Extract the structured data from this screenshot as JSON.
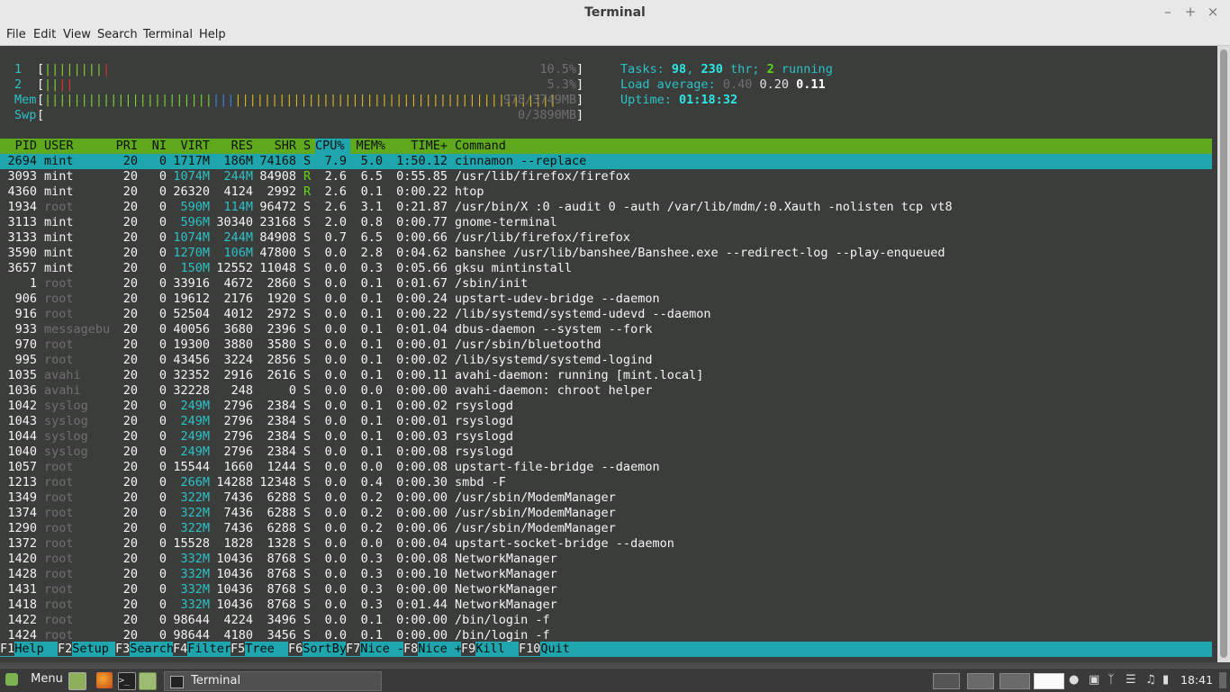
{
  "window": {
    "title": "Terminal"
  },
  "menubar": {
    "items": [
      "File",
      "Edit",
      "View",
      "Search",
      "Terminal",
      "Help"
    ]
  },
  "meters": {
    "cpu1_label": "1",
    "cpu1_value": "10.5%",
    "cpu2_label": "2",
    "cpu2_value": "5.3%",
    "mem_label": "Mem",
    "mem_value": "978/3749MB",
    "swp_label": "Swp",
    "swp_value": "0/3890MB"
  },
  "summary": {
    "tasks_label": "Tasks:",
    "tasks": "98",
    "threads": "230",
    "thr_label": "thr;",
    "running": "2",
    "running_label": "running",
    "load_label": "Load average:",
    "load1": "0.40",
    "load5": "0.20",
    "load15": "0.11",
    "uptime_label": "Uptime:",
    "uptime": "01:18:32"
  },
  "table": {
    "headers": {
      "pid": "PID",
      "user": "USER",
      "pri": "PRI",
      "ni": "NI",
      "virt": "VIRT",
      "res": "RES",
      "shr": "SHR",
      "s": "S",
      "cpu": "CPU%",
      "mem": "MEM%",
      "time": "TIME+",
      "cmd": "Command"
    },
    "rows": [
      [
        "2694",
        "mint",
        "20",
        "0",
        "1717M",
        "186M",
        "74168",
        "S",
        "7.9",
        "5.0",
        "1:50.12",
        "cinnamon --replace"
      ],
      [
        "3093",
        "mint",
        "20",
        "0",
        "1074M",
        "244M",
        "84908",
        "R",
        "2.6",
        "6.5",
        "0:55.85",
        "/usr/lib/firefox/firefox"
      ],
      [
        "4360",
        "mint",
        "20",
        "0",
        "26320",
        "4124",
        "2992",
        "R",
        "2.6",
        "0.1",
        "0:00.22",
        "htop"
      ],
      [
        "1934",
        "root",
        "20",
        "0",
        "590M",
        "114M",
        "96472",
        "S",
        "2.6",
        "3.1",
        "0:21.87",
        "/usr/bin/X :0 -audit 0 -auth /var/lib/mdm/:0.Xauth -nolisten tcp vt8"
      ],
      [
        "3113",
        "mint",
        "20",
        "0",
        "596M",
        "30340",
        "23168",
        "S",
        "2.0",
        "0.8",
        "0:00.77",
        "gnome-terminal"
      ],
      [
        "3133",
        "mint",
        "20",
        "0",
        "1074M",
        "244M",
        "84908",
        "S",
        "0.7",
        "6.5",
        "0:00.66",
        "/usr/lib/firefox/firefox"
      ],
      [
        "3590",
        "mint",
        "20",
        "0",
        "1270M",
        "106M",
        "47800",
        "S",
        "0.0",
        "2.8",
        "0:04.62",
        "banshee /usr/lib/banshee/Banshee.exe --redirect-log --play-enqueued"
      ],
      [
        "3657",
        "mint",
        "20",
        "0",
        "150M",
        "12552",
        "11048",
        "S",
        "0.0",
        "0.3",
        "0:05.66",
        "gksu mintinstall"
      ],
      [
        "1",
        "root",
        "20",
        "0",
        "33916",
        "4672",
        "2860",
        "S",
        "0.0",
        "0.1",
        "0:01.67",
        "/sbin/init"
      ],
      [
        "906",
        "root",
        "20",
        "0",
        "19612",
        "2176",
        "1920",
        "S",
        "0.0",
        "0.1",
        "0:00.24",
        "upstart-udev-bridge --daemon"
      ],
      [
        "916",
        "root",
        "20",
        "0",
        "52504",
        "4012",
        "2972",
        "S",
        "0.0",
        "0.1",
        "0:00.22",
        "/lib/systemd/systemd-udevd --daemon"
      ],
      [
        "933",
        "messagebu",
        "20",
        "0",
        "40056",
        "3680",
        "2396",
        "S",
        "0.0",
        "0.1",
        "0:01.04",
        "dbus-daemon --system --fork"
      ],
      [
        "970",
        "root",
        "20",
        "0",
        "19300",
        "3880",
        "3580",
        "S",
        "0.0",
        "0.1",
        "0:00.01",
        "/usr/sbin/bluetoothd"
      ],
      [
        "995",
        "root",
        "20",
        "0",
        "43456",
        "3224",
        "2856",
        "S",
        "0.0",
        "0.1",
        "0:00.02",
        "/lib/systemd/systemd-logind"
      ],
      [
        "1035",
        "avahi",
        "20",
        "0",
        "32352",
        "2916",
        "2616",
        "S",
        "0.0",
        "0.1",
        "0:00.11",
        "avahi-daemon: running [mint.local]"
      ],
      [
        "1036",
        "avahi",
        "20",
        "0",
        "32228",
        "248",
        "0",
        "S",
        "0.0",
        "0.0",
        "0:00.00",
        "avahi-daemon: chroot helper"
      ],
      [
        "1042",
        "syslog",
        "20",
        "0",
        "249M",
        "2796",
        "2384",
        "S",
        "0.0",
        "0.1",
        "0:00.02",
        "rsyslogd"
      ],
      [
        "1043",
        "syslog",
        "20",
        "0",
        "249M",
        "2796",
        "2384",
        "S",
        "0.0",
        "0.1",
        "0:00.01",
        "rsyslogd"
      ],
      [
        "1044",
        "syslog",
        "20",
        "0",
        "249M",
        "2796",
        "2384",
        "S",
        "0.0",
        "0.1",
        "0:00.03",
        "rsyslogd"
      ],
      [
        "1040",
        "syslog",
        "20",
        "0",
        "249M",
        "2796",
        "2384",
        "S",
        "0.0",
        "0.1",
        "0:00.08",
        "rsyslogd"
      ],
      [
        "1057",
        "root",
        "20",
        "0",
        "15544",
        "1660",
        "1244",
        "S",
        "0.0",
        "0.0",
        "0:00.08",
        "upstart-file-bridge --daemon"
      ],
      [
        "1213",
        "root",
        "20",
        "0",
        "266M",
        "14288",
        "12348",
        "S",
        "0.0",
        "0.4",
        "0:00.30",
        "smbd -F"
      ],
      [
        "1349",
        "root",
        "20",
        "0",
        "322M",
        "7436",
        "6288",
        "S",
        "0.0",
        "0.2",
        "0:00.00",
        "/usr/sbin/ModemManager"
      ],
      [
        "1374",
        "root",
        "20",
        "0",
        "322M",
        "7436",
        "6288",
        "S",
        "0.0",
        "0.2",
        "0:00.00",
        "/usr/sbin/ModemManager"
      ],
      [
        "1290",
        "root",
        "20",
        "0",
        "322M",
        "7436",
        "6288",
        "S",
        "0.0",
        "0.2",
        "0:00.06",
        "/usr/sbin/ModemManager"
      ],
      [
        "1372",
        "root",
        "20",
        "0",
        "15528",
        "1828",
        "1328",
        "S",
        "0.0",
        "0.0",
        "0:00.04",
        "upstart-socket-bridge --daemon"
      ],
      [
        "1420",
        "root",
        "20",
        "0",
        "332M",
        "10436",
        "8768",
        "S",
        "0.0",
        "0.3",
        "0:00.08",
        "NetworkManager"
      ],
      [
        "1428",
        "root",
        "20",
        "0",
        "332M",
        "10436",
        "8768",
        "S",
        "0.0",
        "0.3",
        "0:00.10",
        "NetworkManager"
      ],
      [
        "1431",
        "root",
        "20",
        "0",
        "332M",
        "10436",
        "8768",
        "S",
        "0.0",
        "0.3",
        "0:00.00",
        "NetworkManager"
      ],
      [
        "1418",
        "root",
        "20",
        "0",
        "332M",
        "10436",
        "8768",
        "S",
        "0.0",
        "0.3",
        "0:01.44",
        "NetworkManager"
      ],
      [
        "1422",
        "root",
        "20",
        "0",
        "98644",
        "4224",
        "3496",
        "S",
        "0.0",
        "0.1",
        "0:00.00",
        "/bin/login -f"
      ],
      [
        "1424",
        "root",
        "20",
        "0",
        "98644",
        "4180",
        "3456",
        "S",
        "0.0",
        "0.1",
        "0:00.00",
        "/bin/login -f"
      ]
    ]
  },
  "footer": [
    {
      "key": "F1",
      "label": "Help  "
    },
    {
      "key": "F2",
      "label": "Setup "
    },
    {
      "key": "F3",
      "label": "Search"
    },
    {
      "key": "F4",
      "label": "Filter"
    },
    {
      "key": "F5",
      "label": "Tree  "
    },
    {
      "key": "F6",
      "label": "SortBy"
    },
    {
      "key": "F7",
      "label": "Nice -"
    },
    {
      "key": "F8",
      "label": "Nice +"
    },
    {
      "key": "F9",
      "label": "Kill  "
    },
    {
      "key": "F10",
      "label": "Quit"
    }
  ],
  "taskbar": {
    "menu_label": "Menu",
    "task_label": "Terminal",
    "clock": "18:41",
    "icons": [
      "linux-mint-logo-icon",
      "show-desktop-icon",
      "firefox-icon",
      "terminal-icon",
      "files-icon",
      "user-icon",
      "removable-drive-icon",
      "bluetooth-icon",
      "wifi-icon",
      "volume-icon",
      "battery-icon"
    ]
  },
  "colors": {
    "terminal_bg": "#3b3d3b",
    "header_green": "#5ea91e",
    "selection_cyan": "#1ea5ad",
    "accent_cyan": "#2cc0c7"
  }
}
